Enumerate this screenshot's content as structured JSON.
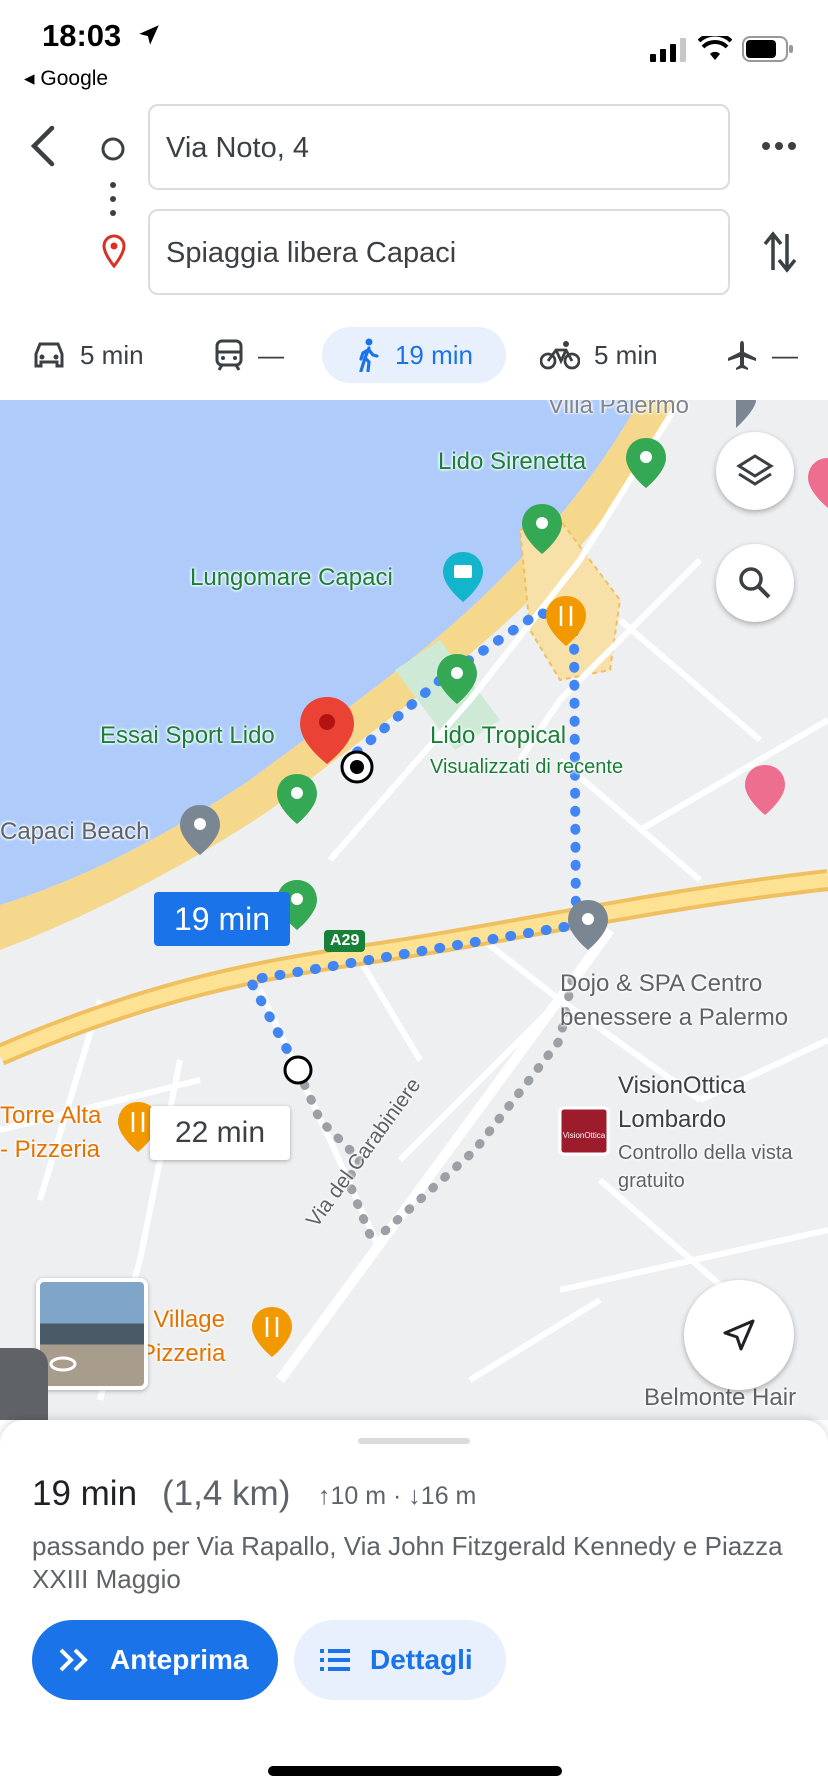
{
  "status": {
    "time": "18:03",
    "back_app": "◂ Google"
  },
  "route": {
    "origin": "Via Noto, 4",
    "destination": "Spiaggia libera Capaci"
  },
  "modes": [
    {
      "icon": "car-icon",
      "label": "5 min"
    },
    {
      "icon": "transit-icon",
      "label": "—"
    },
    {
      "icon": "walk-icon",
      "label": "19 min",
      "selected": true
    },
    {
      "icon": "bike-icon",
      "label": "5 min"
    },
    {
      "icon": "flight-icon",
      "label": "—"
    }
  ],
  "map": {
    "labels": {
      "villa_palermo": "Villa Palermo",
      "lido_sirenetta": "Lido Sirenetta",
      "lungomare": "Lungomare Capaci",
      "essai": "Essai Sport Lido",
      "lido_tropical": "Lido Tropical",
      "recent": "Visualizzati di recente",
      "capaci_beach": "Capaci Beach",
      "highway": "A29",
      "dojo_1": "Dojo & SPA Centro",
      "dojo_2": "benessere a Palermo",
      "vision_1": "VisionOttica",
      "vision_2": "Lombardo",
      "vision_3": "Controllo della vista",
      "vision_4": "gratuito",
      "torre_1": "Torre Alta",
      "torre_2": "- Pizzeria",
      "street_carabiniere": "Via del Carabiniere",
      "village_1": "t Village",
      "village_2": "Pizzeria",
      "belmonte": "Belmonte Hair",
      "vision_logo": "VisionOttica"
    },
    "callouts": {
      "primary": "19 min",
      "alternate": "22 min"
    }
  },
  "sheet": {
    "duration": "19 min",
    "distance": "(1,4 km)",
    "elevation": "↑10 m · ↓16 m",
    "via": "passando per Via Rapallo, Via John Fitzgerald Kennedy e Piazza XXIII Maggio",
    "preview_label": "Anteprima",
    "details_label": "Dettagli"
  },
  "colors": {
    "accent": "#1a73e8",
    "water": "#aecbfa",
    "sand": "#f5d88c",
    "route": "#4285f4"
  }
}
